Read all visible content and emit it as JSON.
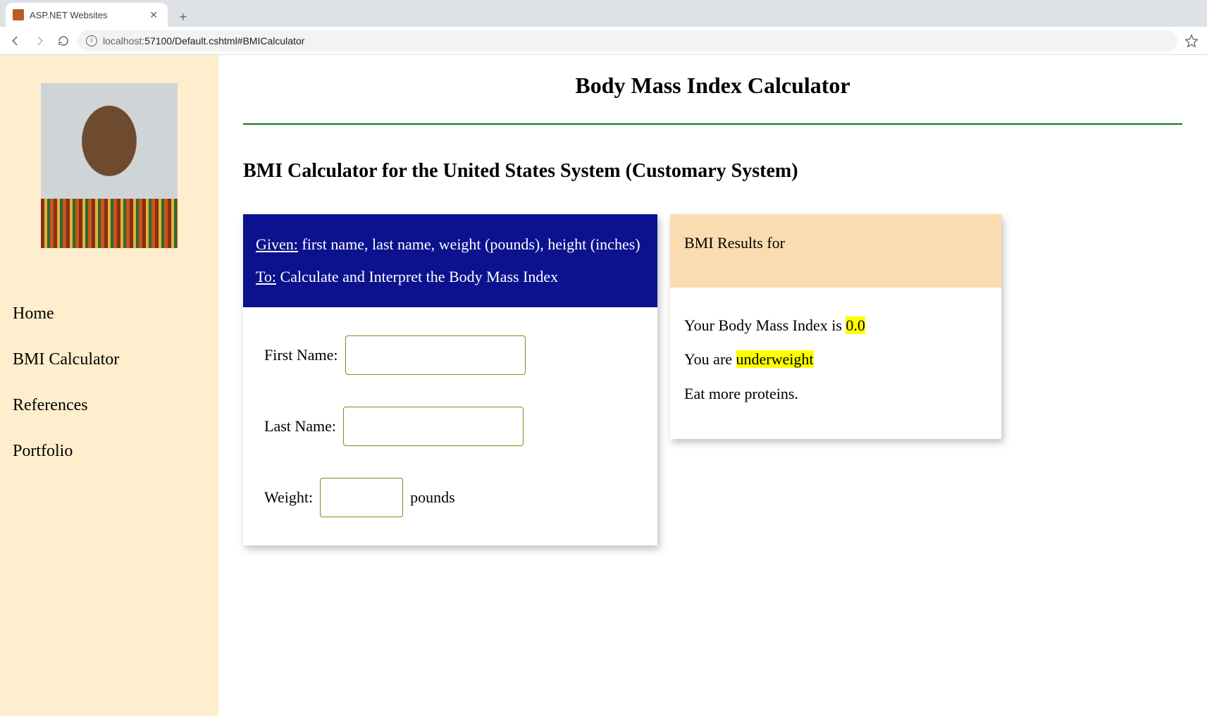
{
  "browser": {
    "tab_title": "ASP.NET Websites",
    "url_host": "localhost:",
    "url_rest": "57100/Default.cshtml#BMICalculator"
  },
  "sidebar": {
    "links": [
      {
        "label": "Home"
      },
      {
        "label": "BMI Calculator"
      },
      {
        "label": "References"
      },
      {
        "label": "Portfolio"
      }
    ]
  },
  "page_title": "Body Mass Index Calculator",
  "section_title": "BMI Calculator for the United States System (Customary System)",
  "calc": {
    "given_label": "Given:",
    "given_text": " first name, last name, weight (pounds), height (inches)",
    "to_label": "To:",
    "to_text": " Calculate and Interpret the Body Mass Index",
    "first_name_label": "First Name:",
    "last_name_label": "Last Name:",
    "weight_label": "Weight:",
    "weight_unit": "pounds",
    "first_name_value": "",
    "last_name_value": "",
    "weight_value": ""
  },
  "result": {
    "header": "BMI Results for",
    "line1_pre": "Your Body Mass Index is ",
    "bmi_value": "0.0",
    "line2_pre": "You are ",
    "status": "underweight",
    "advice": "Eat more proteins."
  }
}
